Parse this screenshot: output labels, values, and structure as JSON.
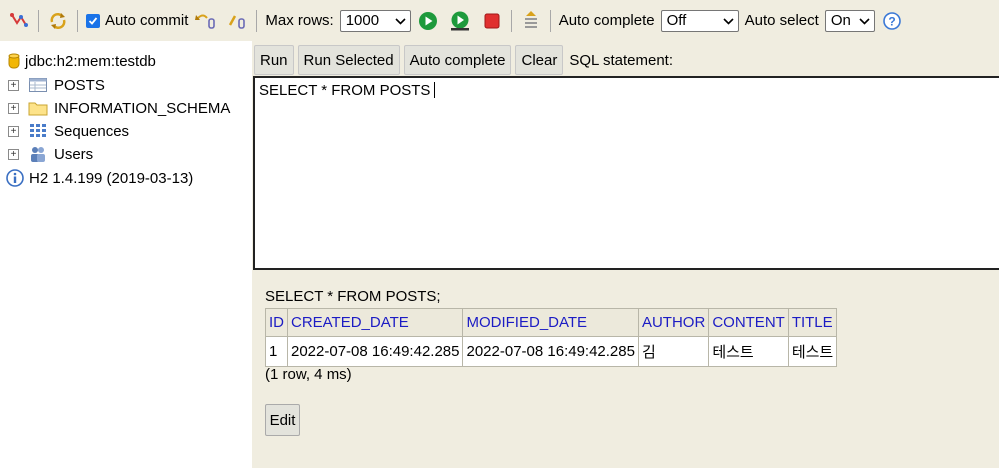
{
  "toolbar": {
    "auto_commit_label": "Auto commit",
    "auto_commit_checked": true,
    "max_rows_label": "Max rows:",
    "max_rows_value": "1000",
    "auto_complete_label": "Auto complete",
    "auto_complete_value": "Off",
    "auto_select_label": "Auto select",
    "auto_select_value": "On",
    "icons": [
      "disconnect-icon",
      "refresh-icon",
      "rollback-icon",
      "commit-icon",
      "run-icon",
      "run-selected-icon",
      "stop-icon",
      "history-icon",
      "help-icon"
    ]
  },
  "tree": {
    "connection": "jdbc:h2:mem:testdb",
    "items": [
      {
        "label": "POSTS",
        "icon": "table-icon"
      },
      {
        "label": "INFORMATION_SCHEMA",
        "icon": "folder-icon"
      },
      {
        "label": "Sequences",
        "icon": "sequences-icon"
      },
      {
        "label": "Users",
        "icon": "users-icon"
      }
    ],
    "version": "H2 1.4.199 (2019-03-13)"
  },
  "editor": {
    "buttons": {
      "run": "Run",
      "run_selected": "Run Selected",
      "auto_complete": "Auto complete",
      "clear": "Clear"
    },
    "sql_label": "SQL statement:",
    "sql_text": "SELECT * FROM POSTS"
  },
  "result": {
    "statement": "SELECT * FROM POSTS;",
    "columns": [
      "ID",
      "CREATED_DATE",
      "MODIFIED_DATE",
      "AUTHOR",
      "CONTENT",
      "TITLE"
    ],
    "rows": [
      [
        "1",
        "2022-07-08 16:49:42.285",
        "2022-07-08 16:49:42.285",
        "김",
        "테스트",
        "테스트"
      ]
    ],
    "row_info": "(1 row, 4 ms)",
    "edit_label": "Edit"
  },
  "colors": {
    "panel_bg": "#f0ede0",
    "header_text": "#1c1cc4",
    "run_green": "#1e9a3c",
    "stop_red": "#e0302f",
    "checkbox_blue": "#1a73e8"
  }
}
